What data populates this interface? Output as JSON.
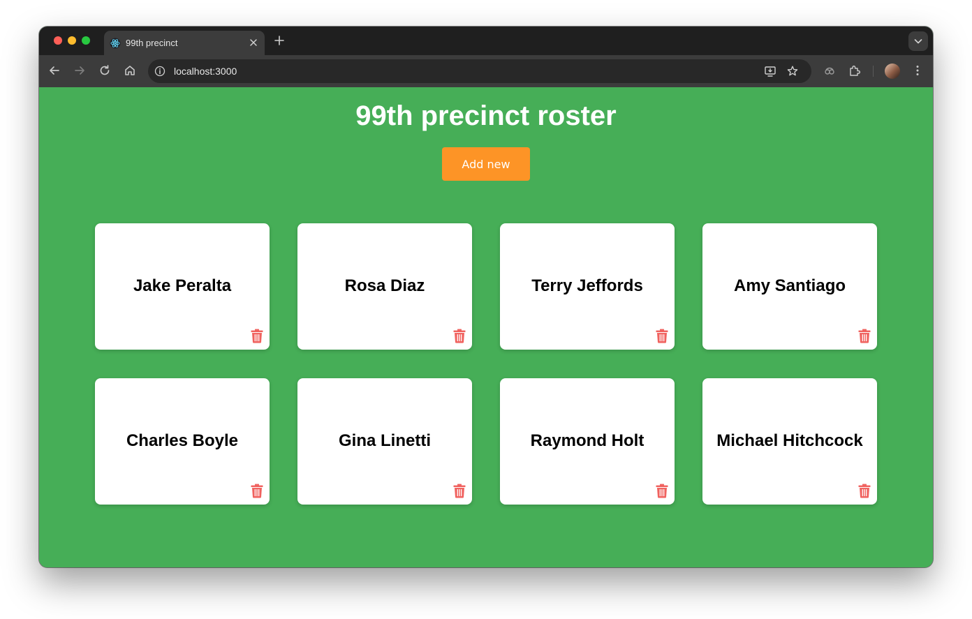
{
  "browser": {
    "tab_title": "99th precinct",
    "url": "localhost:3000"
  },
  "page": {
    "title": "99th precinct roster",
    "add_button_label": "Add new",
    "cards": [
      {
        "name": "Jake Peralta"
      },
      {
        "name": "Rosa Diaz"
      },
      {
        "name": "Terry Jeffords"
      },
      {
        "name": "Amy Santiago"
      },
      {
        "name": "Charles Boyle"
      },
      {
        "name": "Gina Linetti"
      },
      {
        "name": "Raymond Holt"
      },
      {
        "name": "Michael Hitchcock"
      }
    ]
  },
  "colors": {
    "page_background": "#46ae57",
    "add_button": "#fd9426",
    "delete_icon": "#f0625f"
  },
  "icons": [
    "react-icon",
    "close-icon",
    "plus-icon",
    "chevron-down-icon",
    "back-icon",
    "forward-icon",
    "reload-icon",
    "home-icon",
    "info-icon",
    "install-icon",
    "star-icon",
    "performance-icon",
    "extensions-icon",
    "avatar",
    "more-icon",
    "trash-icon"
  ]
}
